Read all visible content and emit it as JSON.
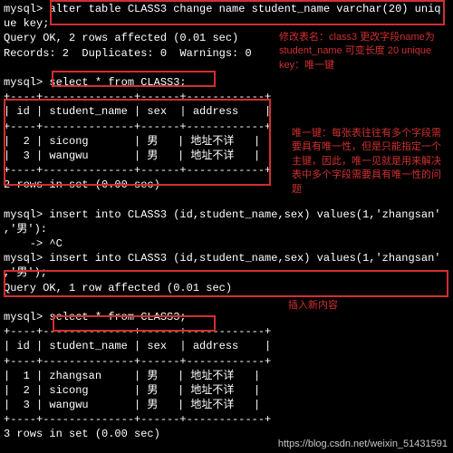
{
  "prompt": "mysql>",
  "lines": {
    "alter1": "mysql> alter table CLASS3 change name student_name varchar(20) uniq",
    "alter2": "ue key;",
    "queryok2": "Query OK, 2 rows affected (0.01 sec)",
    "records": "Records: 2  Duplicates: 0  Warnings: 0",
    "blank": "",
    "select1": "mysql> select * from CLASS3;",
    "sep": "+----+--------------+------+------------+",
    "hdr": "| id | student_name | sex  | address    |",
    "r1": "|  2 | sicong       | 男   | 地址不详   |",
    "r2": "|  3 | wangwu       | 男   | 地址不详   |",
    "rows2": "2 rows in set (0.00 sec)",
    "ins1a": "mysql> insert into CLASS3 (id,student_name,sex) values(1,'zhangsan'",
    "ins1b": ",'男'):",
    "ctrlc": "    -> ^C",
    "ins2a": "mysql> insert into CLASS3 (id,student_name,sex) values(1,'zhangsan'",
    "ins2b": ",'男');",
    "queryok1": "Query OK, 1 row affected (0.01 sec)",
    "r3_1": "|  1 | zhangsan     | 男   | 地址不详   |",
    "r3_2": "|  2 | sicong       | 男   | 地址不详   |",
    "r3_3": "|  3 | wangwu       | 男   | 地址不详   |",
    "rows3": "3 rows in set (0.00 sec)"
  },
  "notes": {
    "n1": "修改表名：class3 更改字段name为 student_name 可变长度 20 unique key：唯一键",
    "n2": "唯一键：每张表往往有多个字段需要具有唯一性，但是只能指定一个主键，因此，唯一见就是用来解决表中多个字段需要具有唯一性的问题",
    "n3": "插入新内容"
  },
  "watermark": "https://blog.csdn.net/weixin_51431591"
}
